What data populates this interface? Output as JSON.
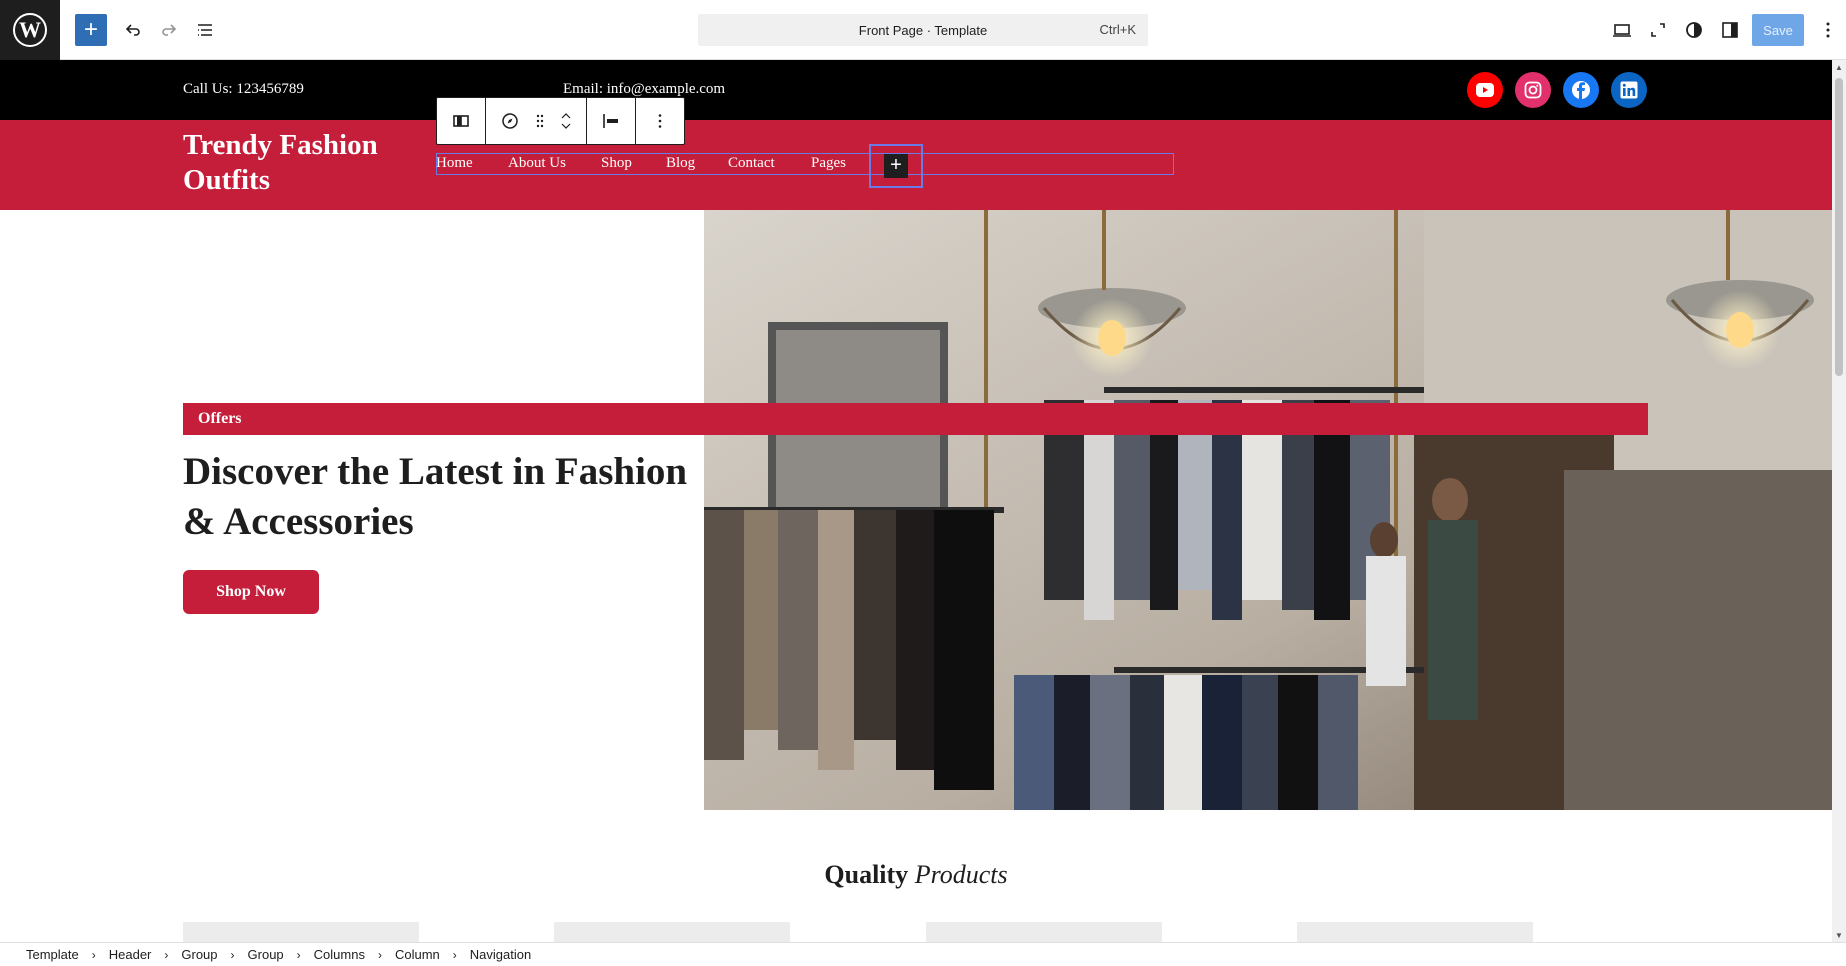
{
  "editor": {
    "document_title": "Front Page · Template",
    "shortcut": "Ctrl+K",
    "save_label": "Save"
  },
  "site": {
    "call": "Call Us: 123456789",
    "email": "Email: info@example.com",
    "title": "Trendy Fashion Outfits",
    "nav": [
      "Home",
      "About Us",
      "Shop",
      "Blog",
      "Contact",
      "Pages"
    ],
    "social": [
      {
        "name": "youtube-icon",
        "color": "#ff0000"
      },
      {
        "name": "instagram-icon",
        "color": "#e1306c"
      },
      {
        "name": "facebook-icon",
        "color": "#1877f2"
      },
      {
        "name": "linkedin-icon",
        "color": "#0a66c2"
      }
    ]
  },
  "hero": {
    "badge": "Offers",
    "title": "Discover the Latest in Fashion & Accessories",
    "button": "Shop Now"
  },
  "section": {
    "quality_bold": "Quality",
    "quality_italic": "Products"
  },
  "breadcrumb": [
    "Template",
    "Header",
    "Group",
    "Group",
    "Columns",
    "Column",
    "Navigation"
  ],
  "colors": {
    "brand": "#c41e3a",
    "topbar": "#000000",
    "editor_accent": "#3858e9"
  }
}
